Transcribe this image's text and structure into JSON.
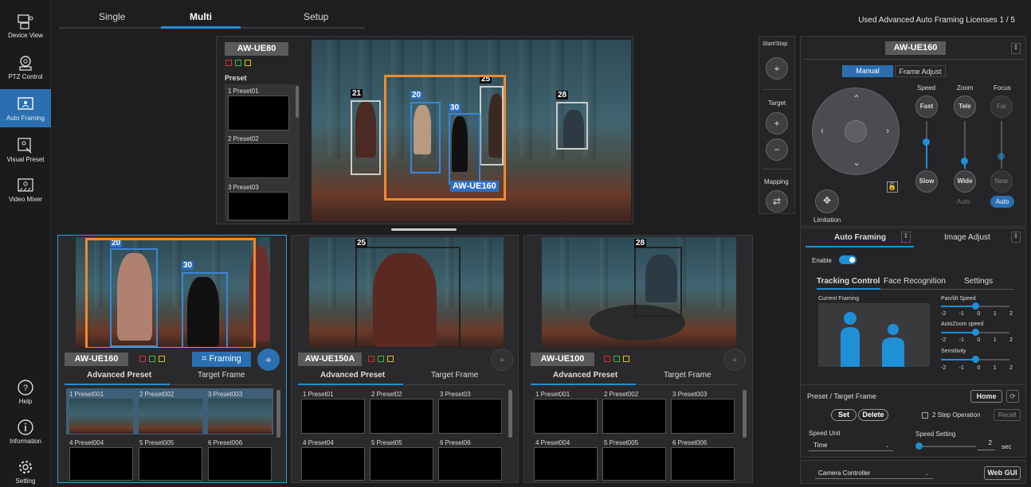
{
  "nav": {
    "items": [
      {
        "label": "Device View"
      },
      {
        "label": "PTZ Control"
      },
      {
        "label": "Auto Framing"
      },
      {
        "label": "Visual Preset"
      },
      {
        "label": "Video Mixer"
      },
      {
        "label": "Help"
      },
      {
        "label": "Information"
      },
      {
        "label": "Setting"
      }
    ]
  },
  "tabs": {
    "single": "Single",
    "multi": "Multi",
    "setup": "Setup"
  },
  "license": "Used Advanced Auto Framing Licenses  1 / 5",
  "main_cam": {
    "name": "AW-UE80",
    "preset_header": "Preset",
    "presets": [
      "1  Preset01",
      "2  Preset02",
      "3  Preset03"
    ],
    "ids": [
      "21",
      "20",
      "25",
      "30",
      "28"
    ],
    "tag": "AW-UE160"
  },
  "cams": [
    {
      "name": "AW-UE160",
      "framing": "Framing",
      "tabs": [
        "Advanced Preset",
        "Target Frame"
      ],
      "presets": [
        "1  Preset001",
        "2  Preset002",
        "3  Preset003",
        "4  Preset004",
        "5  Preset005",
        "6  Preset006"
      ],
      "ids": [
        "20",
        "30"
      ]
    },
    {
      "name": "AW-UE150A",
      "tabs": [
        "Advanced Preset",
        "Target Frame"
      ],
      "presets": [
        "1  Preset01",
        "2  Preset02",
        "3  Preset03",
        "4  Preset04",
        "5  Preset05",
        "6  Preset06"
      ],
      "ids": [
        "25"
      ]
    },
    {
      "name": "AW-UE100",
      "tabs": [
        "Advanced Preset",
        "Target Frame"
      ],
      "presets": [
        "1  Preset001",
        "2  Preset002",
        "3  Preset003",
        "4  Preset004",
        "5  Preset005",
        "6  Preset006"
      ],
      "ids": [
        "28"
      ]
    }
  ],
  "mid": {
    "startstop": "Start/Stop",
    "target": "Target",
    "mapping": "Mapping"
  },
  "right": {
    "cam": "AW-UE160",
    "mode_tabs": [
      "Manual",
      "Frame Adjust"
    ],
    "speed": "Speed",
    "zoom": "Zoom",
    "focus": "Focus",
    "fast": "Fast",
    "slow": "Slow",
    "tele": "Tele",
    "wide": "Wide",
    "far": "Far",
    "near": "Near",
    "auto1": "Auto",
    "auto2": "Auto",
    "limitation": "Limitation",
    "sect_tabs": [
      "Auto Framing",
      "Image Adjust"
    ],
    "enable": "Enable",
    "sub_tabs": [
      "Tracking Control",
      "Face Recognition",
      "Settings"
    ],
    "current_framing": "Current Framing",
    "pantilt": "Pan/tilt Speed",
    "autozoom": "AutoZoom speed",
    "sensitivity": "Sensitivity",
    "scale": [
      "-2",
      "-1",
      "0",
      "1",
      "2"
    ],
    "preset_title": "Preset / Target Frame",
    "home": "Home",
    "set": "Set",
    "delete": "Delete",
    "two_step": "2 Step Operation",
    "recall": "Recall",
    "speed_unit": "Speed Unit",
    "speed_unit_val": "Time",
    "speed_setting": "Speed Setting",
    "speed_val": "2",
    "sec": "sec",
    "controller": "Camera Controller",
    "webgui": "Web GUI"
  }
}
